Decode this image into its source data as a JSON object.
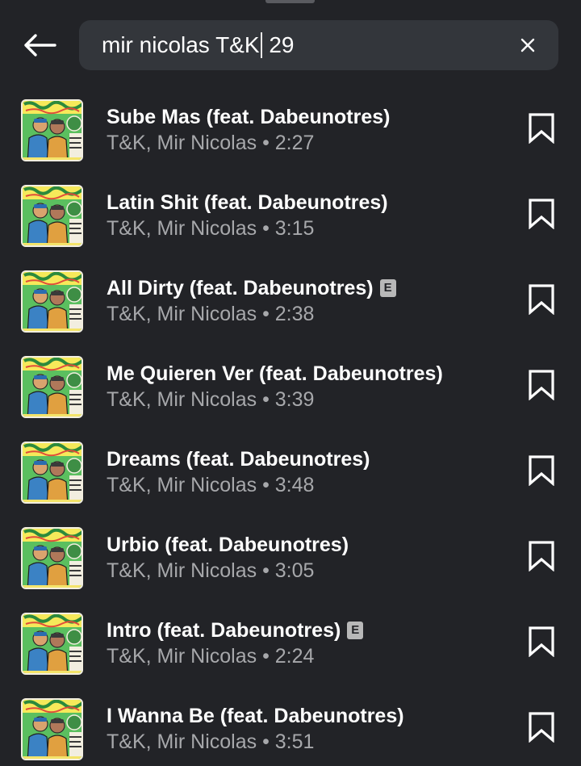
{
  "search": {
    "query_before_cursor": "mir nicolas T&K",
    "query_after_cursor": " 29"
  },
  "icons": {
    "back": "arrow-left-icon",
    "clear": "close-icon",
    "bookmark": "bookmark-icon",
    "explicit_letter": "E"
  },
  "results": [
    {
      "title": "Sube Mas (feat. Dabeunotres)",
      "subtitle": "T&K, Mir Nicolas • 2:27",
      "explicit": false
    },
    {
      "title": "Latin Shit (feat. Dabeunotres)",
      "subtitle": "T&K, Mir Nicolas • 3:15",
      "explicit": false
    },
    {
      "title": "All Dirty (feat. Dabeunotres)",
      "subtitle": "T&K, Mir Nicolas • 2:38",
      "explicit": true
    },
    {
      "title": "Me Quieren Ver (feat. Dabeunotres)",
      "subtitle": "T&K, Mir Nicolas • 3:39",
      "explicit": false
    },
    {
      "title": "Dreams (feat. Dabeunotres)",
      "subtitle": "T&K, Mir Nicolas • 3:48",
      "explicit": false
    },
    {
      "title": "Urbio (feat. Dabeunotres)",
      "subtitle": "T&K, Mir Nicolas • 3:05",
      "explicit": false
    },
    {
      "title": "Intro (feat. Dabeunotres)",
      "subtitle": "T&K, Mir Nicolas • 2:24",
      "explicit": true
    },
    {
      "title": "I Wanna Be (feat. Dabeunotres)",
      "subtitle": "T&K, Mir Nicolas • 3:51",
      "explicit": false
    }
  ]
}
